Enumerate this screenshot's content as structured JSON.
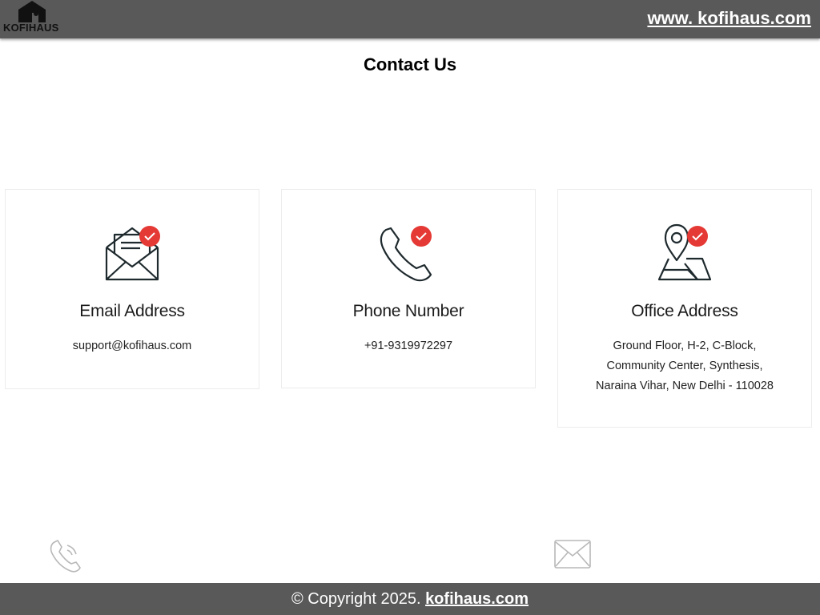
{
  "header": {
    "logo_text": "KOFIHAUS",
    "site_link": "www. kofihaus.com"
  },
  "page": {
    "title": "Contact Us"
  },
  "cards": [
    {
      "title": "Email Address",
      "lines": [
        "support@kofihaus.com"
      ],
      "icon": "envelope-check-icon"
    },
    {
      "title": "Phone Number",
      "lines": [
        "+91-9319972297"
      ],
      "icon": "phone-check-icon"
    },
    {
      "title": "Office Address",
      "lines": [
        "Ground Floor, H-2, C-Block,",
        "Community Center, Synthesis,",
        "Naraina Vihar, New Delhi - 110028"
      ],
      "icon": "map-pin-check-icon"
    }
  ],
  "floating": {
    "phone_icon": "phone-icon",
    "mail_icon": "mail-icon"
  },
  "footer": {
    "copyright": "© Copyright  2025. ",
    "link": "kofihaus.com"
  },
  "colors": {
    "bar": "#595959",
    "badge": "#e53935",
    "icon_stroke": "#1f2a2e"
  }
}
